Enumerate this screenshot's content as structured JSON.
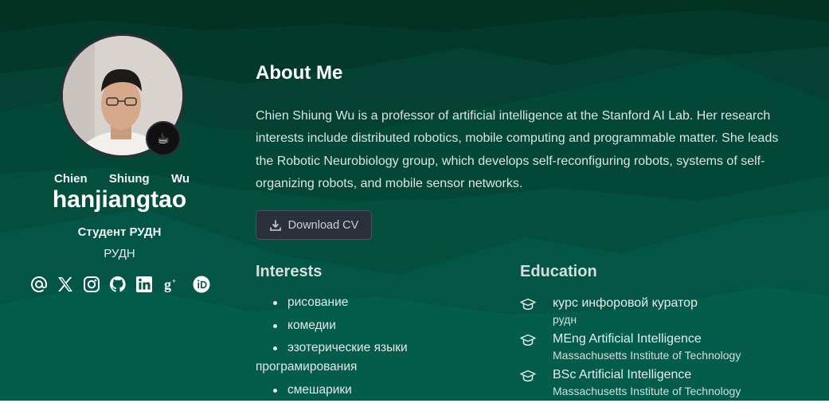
{
  "profile": {
    "name_parts": [
      "Chien",
      "Shiung",
      "Wu"
    ],
    "username": "hanjiangtao",
    "role": "Студент РУДН",
    "organization": "РУДН",
    "status_emoji": "☕"
  },
  "social_icons": [
    "email-icon",
    "x-twitter-icon",
    "instagram-icon",
    "github-icon",
    "linkedin-icon",
    "google-scholar-icon",
    "orcid-icon"
  ],
  "about": {
    "title": "About Me",
    "bio": "Chien Shiung Wu is a professor of artificial intelligence at the Stanford AI Lab. Her research interests include distributed robotics, mobile computing and programmable matter. She leads the Robotic Neurobiology group, which develops self-reconfiguring robots, systems of self-organizing robots, and mobile sensor networks.",
    "cv_button": "Download CV"
  },
  "interests": {
    "title": "Interests",
    "items": [
      "рисование",
      "комедии",
      "эзотерические языки програмирования",
      "смешарики"
    ]
  },
  "education": {
    "title": "Education",
    "items": [
      {
        "degree": "курс инфоровой куратор",
        "institution": "рудн"
      },
      {
        "degree": "MEng Artificial Intelligence",
        "institution": "Massachusetts Institute of Technology"
      },
      {
        "degree": "BSc Artificial Intelligence",
        "institution": "Massachusetts Institute of Technology"
      }
    ]
  },
  "colors": {
    "background_top": "#033324",
    "background_bottom": "#045a48",
    "button_bg": "#2a303a"
  }
}
